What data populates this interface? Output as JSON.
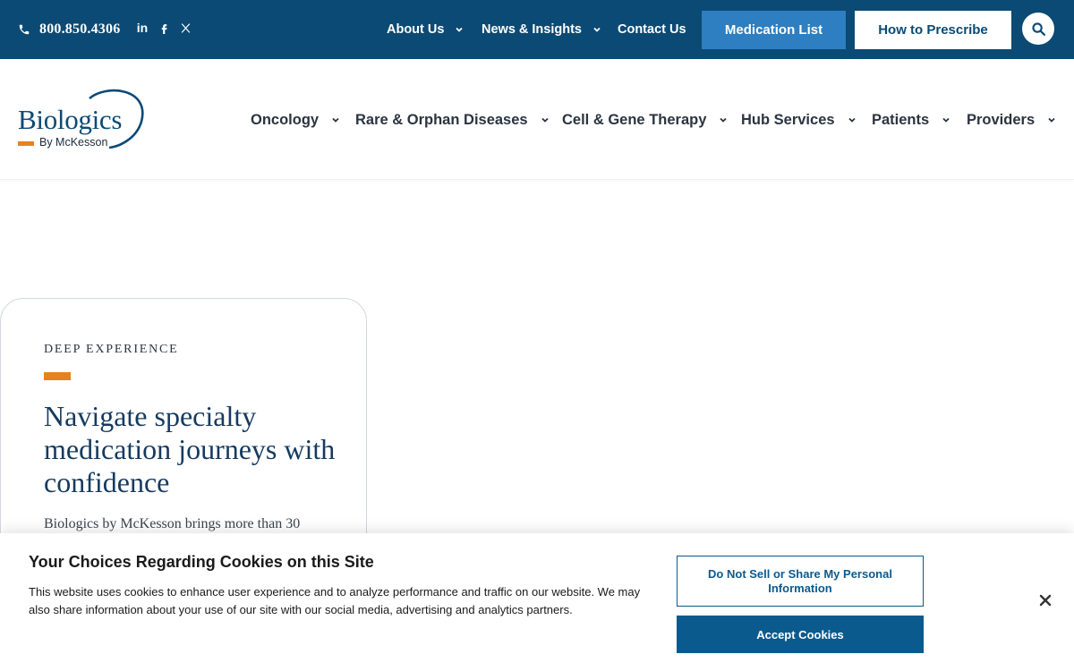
{
  "topbar": {
    "phone": "800.850.4306",
    "social_icons": [
      "linkedin-icon",
      "facebook-icon",
      "x-icon"
    ],
    "linkedin_glyph": "in",
    "links": [
      {
        "label": "About Us"
      },
      {
        "label": "News & Insights"
      },
      {
        "label": "Contact Us"
      }
    ],
    "medication_list_label": "Medication List",
    "how_to_prescribe_label": "How to Prescribe"
  },
  "logo": {
    "word": "Biologics",
    "sub": "By McKesson"
  },
  "nav": {
    "items": [
      {
        "label": "Oncology"
      },
      {
        "label": "Rare & Orphan Diseases"
      },
      {
        "label": "Cell & Gene Therapy"
      },
      {
        "label": "Hub Services"
      },
      {
        "label": "Patients"
      },
      {
        "label": "Providers"
      }
    ]
  },
  "hero": {
    "eyebrow": "DEEP EXPERIENCE",
    "headline": "Navigate specialty medication journeys with confidence",
    "body": "Biologics by McKesson brings more than 30"
  },
  "cookie": {
    "title": "Your Choices Regarding Cookies on this Site",
    "text": "This website uses cookies to enhance user experience and to analyze performance and traffic on our website. We may also share information about your use of our site with our social media, advertising and analytics partners.",
    "do_not_sell_label": "Do Not Sell or Share My Personal Information",
    "accept_label": "Accept Cookies"
  },
  "colors": {
    "brand_navy": "#0b4a74",
    "button_blue": "#2d7fc1",
    "accent_orange": "#e5821f",
    "cookie_blue": "#0b5a8e"
  }
}
